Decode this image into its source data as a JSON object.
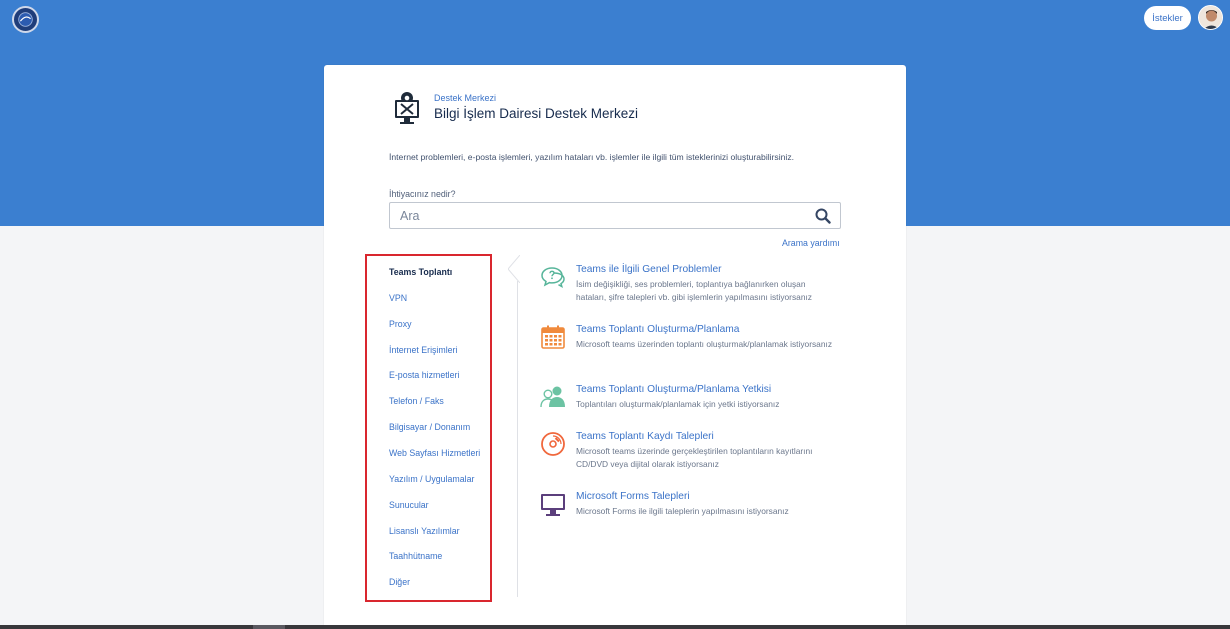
{
  "header": {
    "requests_label": "İstekler",
    "accent": "#3b7fd0"
  },
  "card": {
    "breadcrumb": "Destek Merkezi",
    "title": "Bilgi İşlem Dairesi Destek Merkezi",
    "description": "İnternet problemleri, e-posta işlemleri, yazılım hataları vb. işlemler ile ilgili tüm isteklerinizi oluşturabilirsiniz.",
    "search": {
      "label": "İhtiyacınız nedir?",
      "placeholder": "Ara",
      "help": "Arama yardımı"
    }
  },
  "categories": [
    {
      "label": "Teams Toplantı",
      "active": true
    },
    {
      "label": "VPN"
    },
    {
      "label": "Proxy"
    },
    {
      "label": "İnternet Erişimleri"
    },
    {
      "label": "E-posta hizmetleri"
    },
    {
      "label": "Telefon / Faks"
    },
    {
      "label": "Bilgisayar / Donanım"
    },
    {
      "label": "Web Sayfası Hizmetleri"
    },
    {
      "label": "Yazılım / Uygulamalar"
    },
    {
      "label": "Sunucular"
    },
    {
      "label": "Lisanslı Yazılımlar"
    },
    {
      "label": "Taahhütname"
    },
    {
      "label": "Diğer"
    }
  ],
  "request_types": [
    {
      "icon": "chat-question-icon",
      "title": "Teams ile İlgili Genel Problemler",
      "description": "İsim değişikliği, ses problemleri, toplantıya bağlanırken oluşan hataları, şifre talepleri vb. gibi işlemlerin yapılmasını istiyorsanız"
    },
    {
      "icon": "calendar-icon",
      "title": "Teams Toplantı Oluşturma/Planlama",
      "description": "Microsoft teams üzerinden toplantı oluşturmak/planlamak istiyorsanız"
    },
    {
      "icon": "users-icon",
      "title": "Teams Toplantı Oluşturma/Planlama Yetkisi",
      "description": "Toplantıları oluşturmak/planlamak için yetki istiyorsanız"
    },
    {
      "icon": "disc-icon",
      "title": "Teams Toplantı Kaydı Talepleri",
      "description": "Microsoft teams üzerinde gerçekleştirilen toplantıların kayıtlarını CD/DVD veya dijital olarak istiyorsanız"
    },
    {
      "icon": "monitor-icon",
      "title": "Microsoft Forms Talepleri",
      "description": "Microsoft Forms ile ilgili taleplerin yapılmasını istiyorsanız"
    }
  ]
}
